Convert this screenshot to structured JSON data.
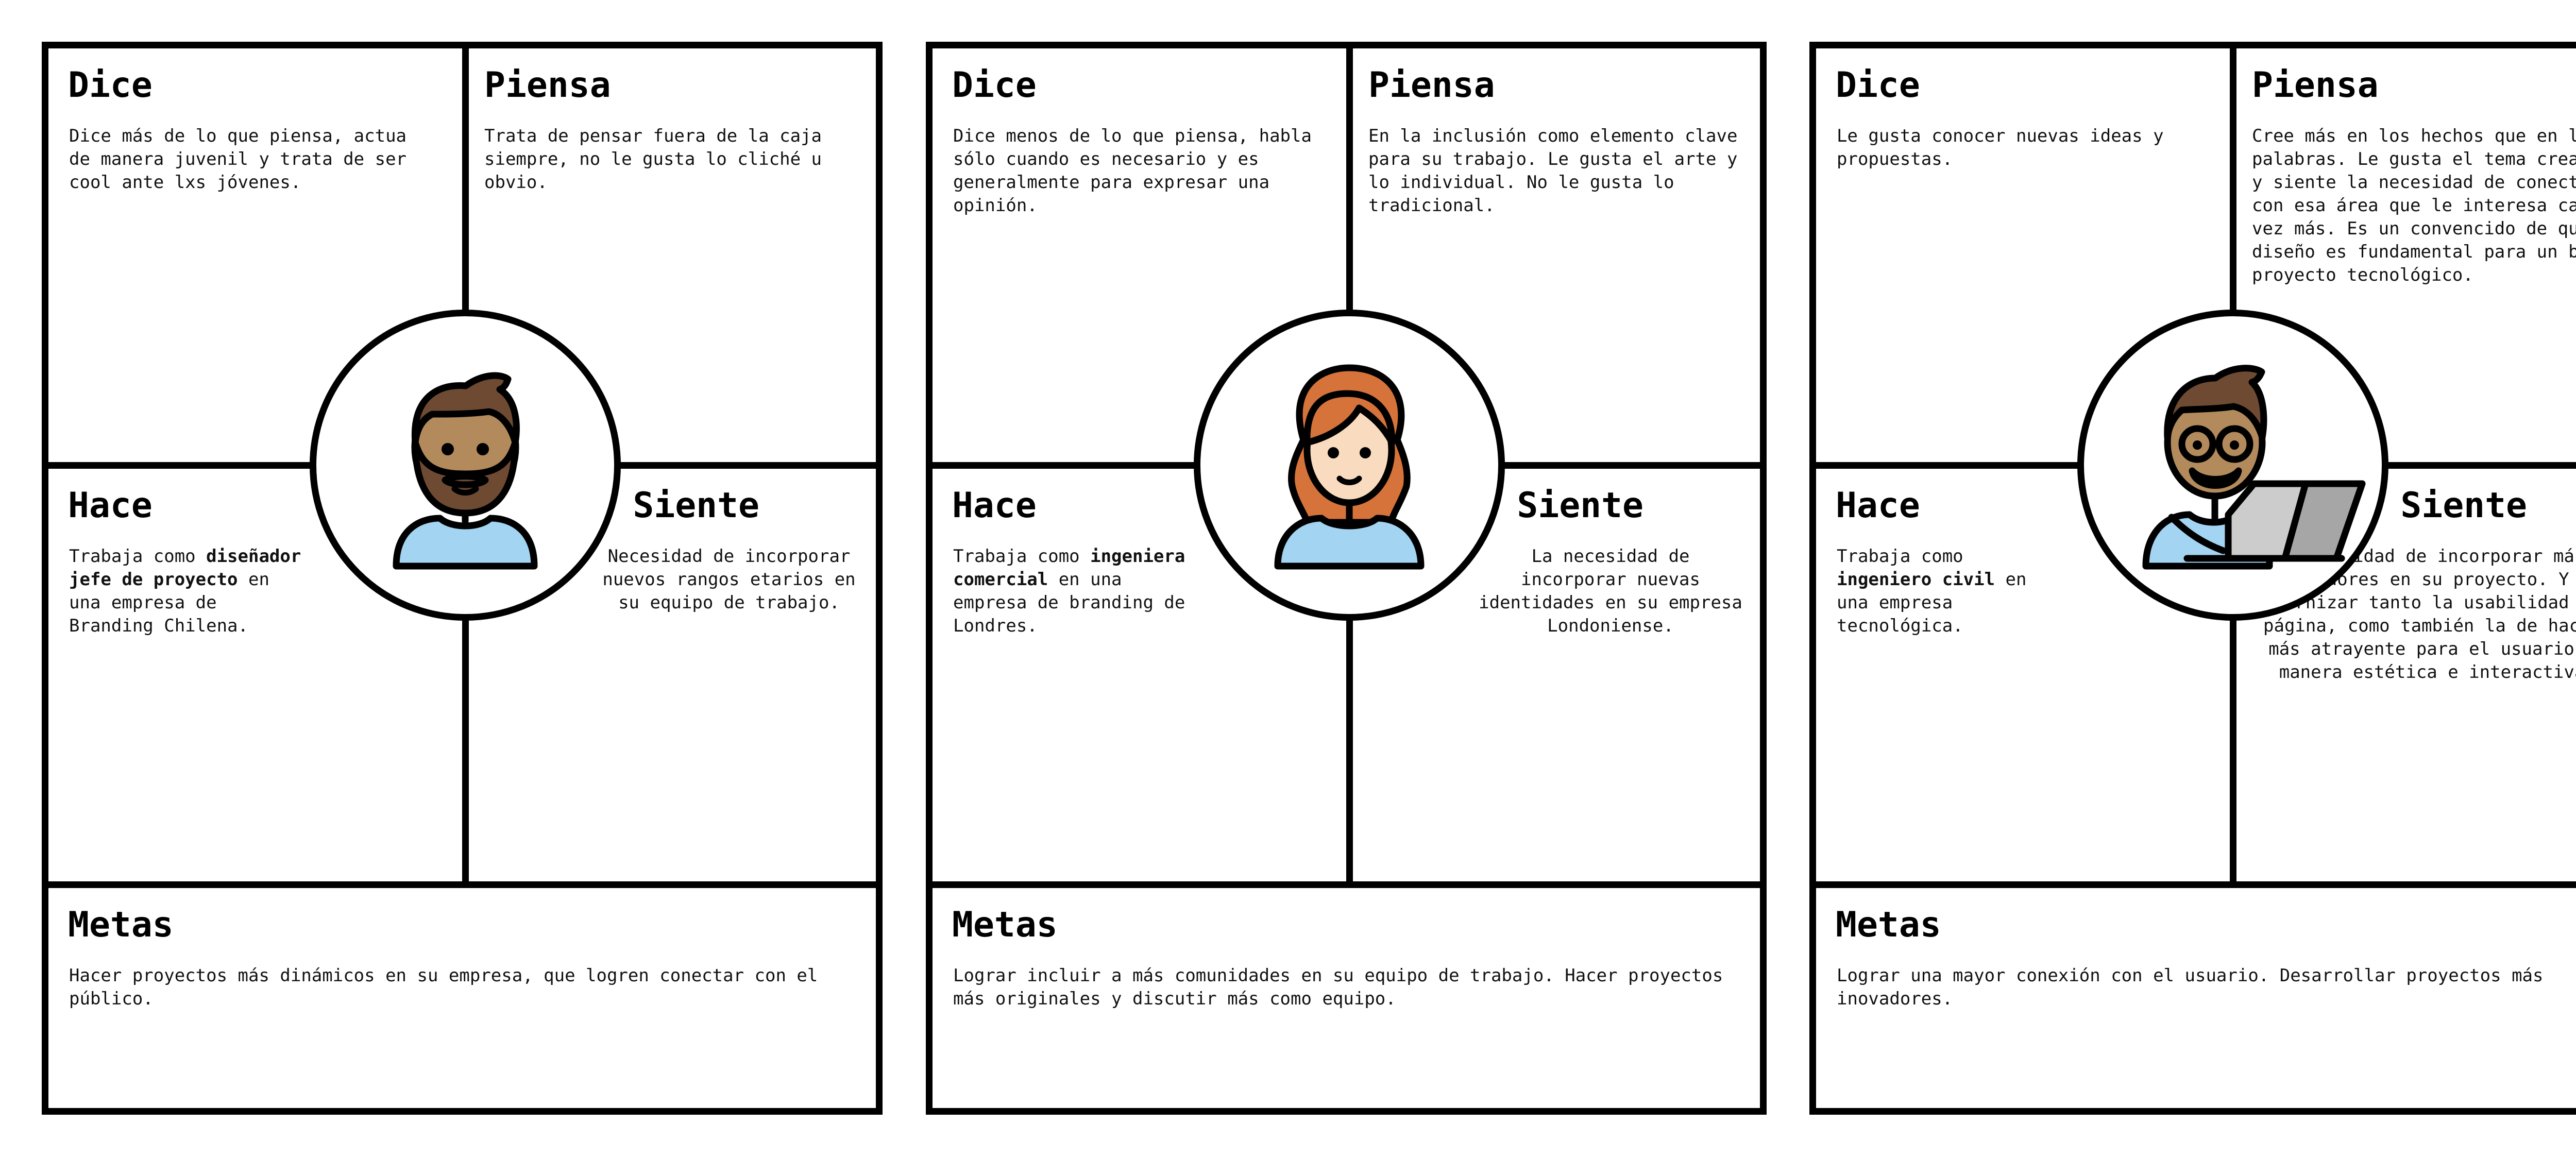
{
  "cards": [
    {
      "avatar": "bearded-man-icon",
      "dice": {
        "title": "Dice",
        "text": "Dice más de lo que piensa, actua de manera juvenil y trata de ser cool ante lxs jóvenes."
      },
      "piensa": {
        "title": "Piensa",
        "text": "Trata de pensar fuera de la caja siempre, no le gusta lo cliché u obvio."
      },
      "hace": {
        "title": "Hace",
        "text_before": "Trabaja como ",
        "bold": "diseñador jefe de proyecto",
        "text_after": " en una empresa de Branding Chilena."
      },
      "siente": {
        "title": "Siente",
        "text": "Necesidad de incorporar nuevos rangos etarios en su equipo de trabajo."
      },
      "metas": {
        "title": "Metas",
        "text": "Hacer proyectos más dinámicos en su empresa, que logren conectar con el público."
      }
    },
    {
      "avatar": "red-haired-woman-icon",
      "dice": {
        "title": "Dice",
        "text": "Dice menos de lo que piensa, habla sólo cuando es necesario y es generalmente para expresar una opinión."
      },
      "piensa": {
        "title": "Piensa",
        "text": "En la inclusión como elemento clave para su trabajo. Le gusta el arte y lo individual. No le gusta lo tradicional."
      },
      "hace": {
        "title": "Hace",
        "text_before": "Trabaja como ",
        "bold": "ingeniera comercial",
        "text_after": " en una empresa de branding de Londres."
      },
      "siente": {
        "title": "Siente",
        "text": "La necesidad de incorporar nuevas identidades en su empresa Londoniense."
      },
      "metas": {
        "title": "Metas",
        "text": "Lograr incluir a más comunidades en su equipo de trabajo. Hacer proyectos más originales y discutir más como equipo."
      }
    },
    {
      "avatar": "man-with-laptop-icon",
      "dice": {
        "title": "Dice",
        "text": "Le gusta conocer nuevas ideas y propuestas."
      },
      "piensa": {
        "title": "Piensa",
        "text": "Cree más en los hechos que en las palabras. Le gusta el tema creativo y siente la necesidad de conectar con esa área que le interesa cada vez más. Es un convencido de que el diseño es fundamental para un buen proyecto tecnológico."
      },
      "hace": {
        "title": "Hace",
        "text_before": "Trabaja como ",
        "bold": "ingeniero civil",
        "text_after": " en una empresa tecnológica."
      },
      "siente": {
        "title": "Siente",
        "text": "Necesidad de incorporar más diseñadores en su proyecto. Y así, modernizar tanto la usabilidad de su página, como también la de hacerla más atrayente para el usuario (de manera estética e interactiva)."
      },
      "metas": {
        "title": "Metas",
        "text": "Lograr una mayor conexión con el usuario. Desarrollar proyectos más inovadores."
      }
    }
  ],
  "colors": {
    "border": "#000000",
    "shirt": "#a3d4f2",
    "skin_tan": "#b38a5c",
    "skin_light": "#f9dcc0",
    "hair_brown": "#6e4a32",
    "hair_red": "#d5733a",
    "laptop": "#cccccc"
  }
}
